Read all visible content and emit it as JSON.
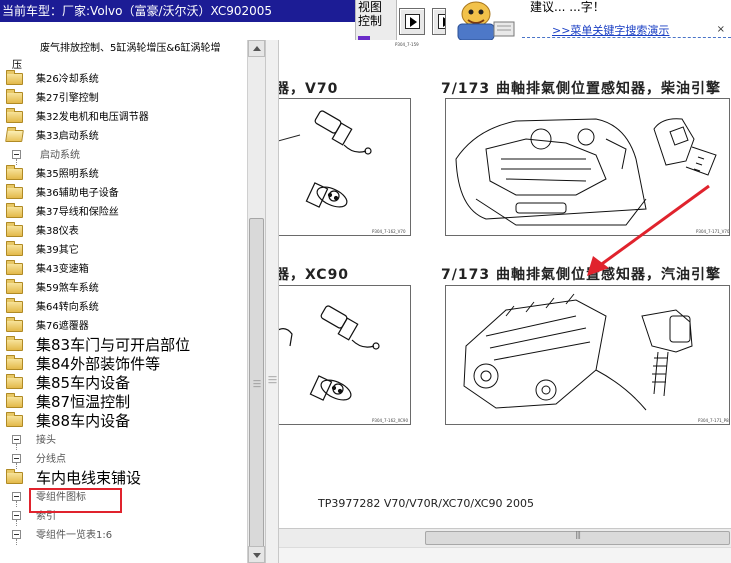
{
  "window": {
    "title": "当前车型：厂家:Volvo（富豪/沃尔沃）XC902005",
    "view_control": [
      "视图",
      "控制"
    ]
  },
  "help": {
    "text": "建议...  ...字！",
    "link": ">>菜单关键字搜索演示"
  },
  "tree": {
    "wrapped_item": {
      "line1": "废气排放控制、5缸涡轮增压&6缸涡轮增",
      "line2": "压"
    },
    "items": [
      {
        "label": "集26冷却系统",
        "kind": "folder",
        "size": "small"
      },
      {
        "label": "集27引擎控制",
        "kind": "folder",
        "size": "small"
      },
      {
        "label": "集32发电机和电压调节器",
        "kind": "folder",
        "size": "small"
      },
      {
        "label": "集33启动系统",
        "kind": "folder-open",
        "size": "small"
      },
      {
        "label": "启动系统",
        "kind": "leaf",
        "size": "small"
      },
      {
        "label": "集35照明系统",
        "kind": "folder",
        "size": "small"
      },
      {
        "label": "集36辅助电子设备",
        "kind": "folder",
        "size": "small"
      },
      {
        "label": "集37导线和保险丝",
        "kind": "folder",
        "size": "small"
      },
      {
        "label": "集38仪表",
        "kind": "folder",
        "size": "small"
      },
      {
        "label": "集39其它",
        "kind": "folder",
        "size": "small"
      },
      {
        "label": "集43变速箱",
        "kind": "folder",
        "size": "small"
      },
      {
        "label": "集59煞车系统",
        "kind": "folder",
        "size": "small"
      },
      {
        "label": "集64转向系统",
        "kind": "folder",
        "size": "small"
      },
      {
        "label": "集76遮覆器",
        "kind": "folder",
        "size": "small"
      },
      {
        "label": "集83车门与可开启部位",
        "kind": "folder",
        "size": "big"
      },
      {
        "label": "集84外部装饰件等",
        "kind": "folder",
        "size": "big"
      },
      {
        "label": "集85车内设备",
        "kind": "folder",
        "size": "big"
      },
      {
        "label": "集87恒温控制",
        "kind": "folder",
        "size": "big"
      },
      {
        "label": "集88车内设备",
        "kind": "folder",
        "size": "big"
      },
      {
        "label": "接头",
        "kind": "leaf",
        "size": "small"
      },
      {
        "label": "分线点",
        "kind": "leaf",
        "size": "small"
      },
      {
        "label": "车内电线束铺设",
        "kind": "folder",
        "size": "big"
      },
      {
        "label": "零组件图标",
        "kind": "leaf",
        "size": "small"
      },
      {
        "label": "索引",
        "kind": "leaf",
        "size": "small"
      },
      {
        "label": "零组件一览表1:6",
        "kind": "leaf",
        "size": "small"
      }
    ]
  },
  "document": {
    "headings": [
      {
        "id": "h1",
        "text": "器，V70"
      },
      {
        "id": "h2",
        "text": "7/173  曲軸排氣側位置感知器，柴油引擎"
      },
      {
        "id": "h3",
        "text": "器，XC90"
      },
      {
        "id": "h4",
        "text": "7/173  曲軸排氣側位置感知器，汽油引擎"
      }
    ],
    "fig_captions": [
      "P304_7-162_V70",
      "P304_7-171_V70",
      "P304_7-162_XC90",
      "P304_7-171_P8"
    ],
    "footer": "TP3977282 V70/V70R/XC70/XC90 2005",
    "top_caption": "P304_7-159"
  },
  "colors": {
    "titlebar": "#1c1c95",
    "highlight": "#e0232d",
    "arrow": "#e0232d",
    "link": "#1a3fc4"
  }
}
